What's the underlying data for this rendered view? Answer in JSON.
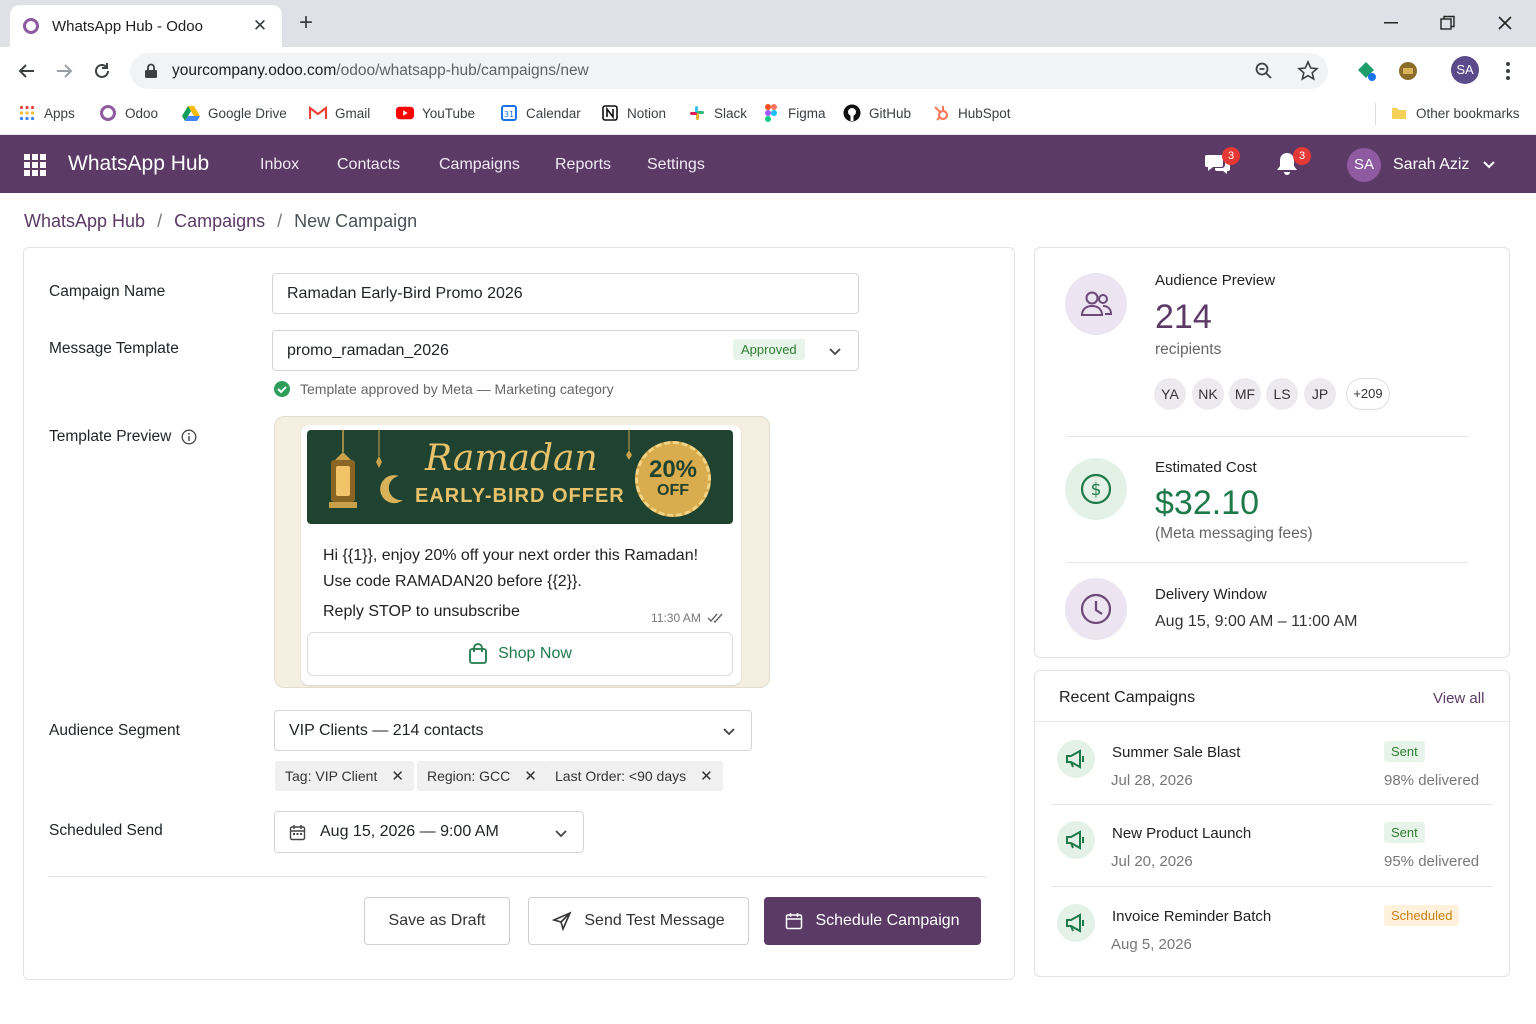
{
  "browser": {
    "tab_title": "WhatsApp Hub - Odoo",
    "url_domain": "yourcompany.odoo.com",
    "url_path": "/odoo/whatsapp-hub/campaigns/new",
    "profile_initials": "SA",
    "bookmarks": [
      "Apps",
      "Odoo",
      "Google Drive",
      "Gmail",
      "YouTube",
      "Calendar",
      "Notion",
      "Slack",
      "Figma",
      "GitHub",
      "HubSpot"
    ],
    "other_bookmarks": "Other bookmarks"
  },
  "app": {
    "title": "WhatsApp Hub",
    "nav": [
      "Inbox",
      "Contacts",
      "Campaigns",
      "Reports",
      "Settings"
    ],
    "chat_badge": "3",
    "bell_badge": "3",
    "user_initials": "SA",
    "user_name": "Sarah Aziz",
    "brand_color": "#5b3a66"
  },
  "breadcrumb": {
    "root": "WhatsApp Hub",
    "parent": "Campaigns",
    "current": "New Campaign",
    "sep": "/"
  },
  "form": {
    "campaign_name_label": "Campaign Name",
    "campaign_name_value": "Ramadan Early-Bird Promo 2026",
    "template_label": "Message Template",
    "template_value": "promo_ramadan_2026",
    "template_status": "Approved",
    "template_hint": "Template approved by Meta — Marketing category",
    "preview_label": "Template Preview",
    "banner_title": "Ramadan",
    "banner_subtitle": "EARLY-BIRD OFFER",
    "banner_pct": "20%",
    "banner_off": "OFF",
    "message_body": "Hi {{1}}, enjoy 20% off your next order this Ramadan! Use code RAMADAN20 before {{2}}.",
    "message_footer": "Reply STOP to unsubscribe",
    "message_time": "11:30 AM",
    "cta_label": "Shop Now",
    "audience_label": "Audience Segment",
    "audience_value": "VIP Clients — 214 contacts",
    "filters": [
      "Tag: VIP Client",
      "Region: GCC",
      "Last Order: <90 days"
    ],
    "schedule_label": "Scheduled Send",
    "schedule_value": "Aug 15, 2026 — 9:00 AM",
    "btn_draft": "Save as Draft",
    "btn_test": "Send Test Message",
    "btn_schedule": "Schedule Campaign"
  },
  "summary": {
    "audience_title": "Audience Preview",
    "audience_count": "214",
    "audience_unit": "recipients",
    "avatars": [
      "YA",
      "NK",
      "MF",
      "LS",
      "JP"
    ],
    "avatars_more": "+209",
    "cost_title": "Estimated Cost",
    "cost_value": "$32.10",
    "cost_note": "(Meta messaging fees)",
    "window_title": "Delivery Window",
    "window_value": "Aug 15, 9:00 AM – 11:00 AM"
  },
  "recent": {
    "title": "Recent Campaigns",
    "view_all": "View all",
    "items": [
      {
        "name": "Summer Sale Blast",
        "date": "Jul 28, 2026",
        "status": "Sent",
        "delivered": "98% delivered"
      },
      {
        "name": "New Product Launch",
        "date": "Jul 20, 2026",
        "status": "Sent",
        "delivered": "95% delivered"
      },
      {
        "name": "Invoice Reminder Batch",
        "date": "Aug 5, 2026",
        "status": "Scheduled",
        "delivered": ""
      }
    ]
  }
}
